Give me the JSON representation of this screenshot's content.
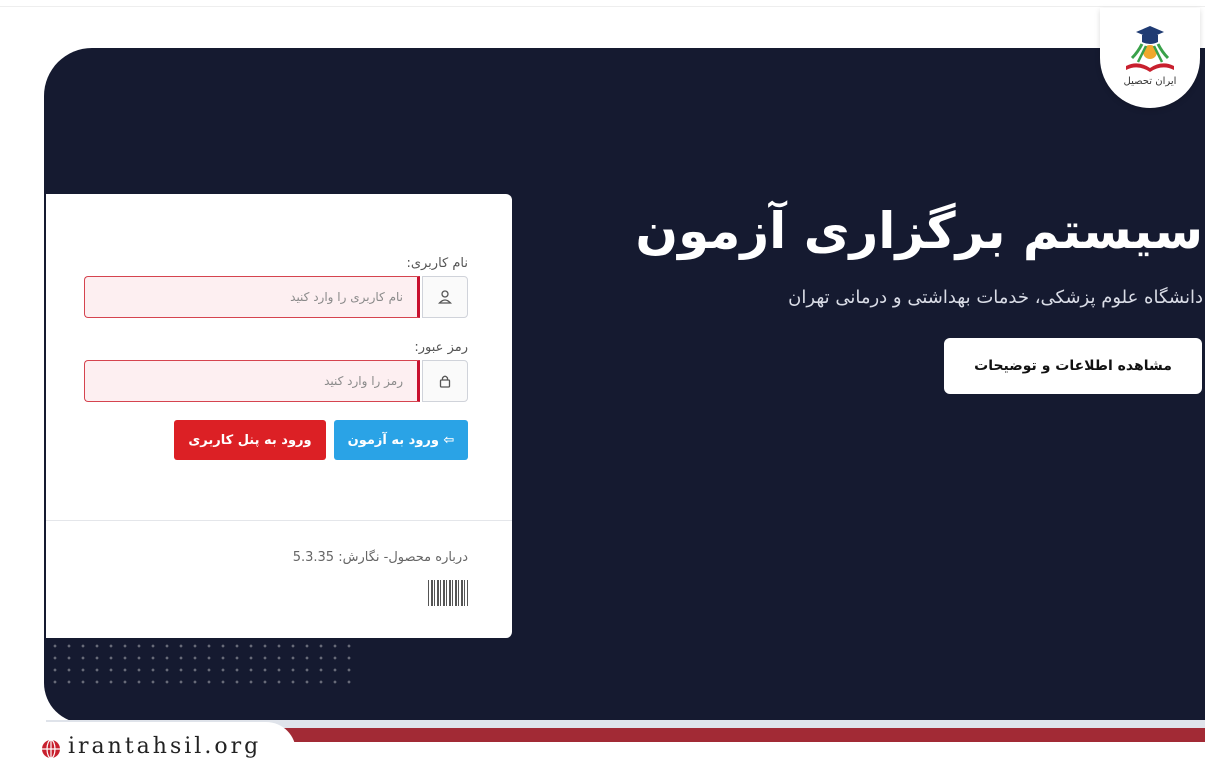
{
  "logo": {
    "text": "ایران تحصیل",
    "icon": "graduation-book-logo"
  },
  "hero": {
    "title": "سیستم برگزاری آزمون",
    "subtitle": "دانشگاه علوم پزشکی، خدمات بهداشتی و درمانی تهران",
    "info_button": "مشاهده اطلاعات و توضیحات"
  },
  "login": {
    "username_label": "نام کاربری:",
    "username_placeholder": "نام کاربری را وارد کنید",
    "username_icon": "user-icon",
    "password_label": "رمز عبور:",
    "password_placeholder": "رمز را وارد کنید",
    "password_icon": "lock-icon",
    "exam_button": "ورود به آزمون",
    "exam_button_icon": "login-arrow-icon",
    "panel_button": "ورود به پنل کاربری",
    "about_text": "درباره محصول- نگارش: 5.3.35"
  },
  "watermark": {
    "text": "irantahsil.org",
    "icon": "globe-icon"
  },
  "colors": {
    "background": "#151a30",
    "exam_button": "#2aa3e6",
    "panel_button": "#dc2025",
    "input_error_bg": "#fdeff1",
    "input_error_border": "#c8102e",
    "accent_strip": "#a22a35"
  }
}
